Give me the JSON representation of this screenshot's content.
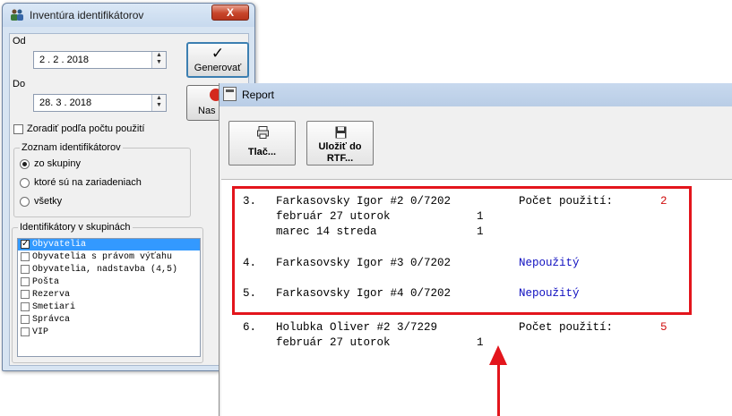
{
  "dialog": {
    "title": "Inventúra identifikátorov",
    "close_label": "X",
    "od_label": "Od",
    "od_value": "2 . 2 . 2018",
    "do_label": "Do",
    "do_value": "28. 3 . 2018",
    "generate_label": "Generovať",
    "nas_label": "Nas",
    "sort_checkbox_label": "Zoradiť podľa počtu použití",
    "list_group": {
      "title": "Zoznam identifikátorov",
      "options": [
        "zo skupiny",
        "ktoré sú na zariadeniach",
        "všetky"
      ],
      "selected_index": 0
    },
    "groups_group": {
      "title": "Identifikátory v skupinách",
      "items": [
        {
          "label": "Obyvatelia",
          "checked": true
        },
        {
          "label": "Obyvatelia s právom výťahu",
          "checked": false
        },
        {
          "label": "Obyvatelia, nadstavba (4,5)",
          "checked": false
        },
        {
          "label": "Pošta",
          "checked": false
        },
        {
          "label": "Rezerva",
          "checked": false
        },
        {
          "label": "Smetiari",
          "checked": false
        },
        {
          "label": "Správca",
          "checked": false
        },
        {
          "label": "VIP",
          "checked": false
        }
      ]
    }
  },
  "report": {
    "title": "Report",
    "print_label": "Tlač...",
    "save_label_1": "Uložiť do",
    "save_label_2": "RTF...",
    "entries": [
      {
        "num": "3.",
        "name": "Farkasovsky Igor #2 0/7202",
        "status_label": "Počet použití:",
        "count": "2",
        "details": [
          {
            "date": "február 27 utorok",
            "count": "1"
          },
          {
            "date": "marec 14 streda",
            "count": "1"
          }
        ]
      },
      {
        "num": "4.",
        "name": "Farkasovsky Igor #3 0/7202",
        "status": "Nepoužitý"
      },
      {
        "num": "5.",
        "name": "Farkasovsky Igor #4 0/7202",
        "status": "Nepoužitý"
      },
      {
        "num": "6.",
        "name": "Holubka Oliver #2 3/7229",
        "status_label": "Počet použití:",
        "count": "5",
        "details": [
          {
            "date": "február 27 utorok",
            "count": "1"
          }
        ]
      }
    ]
  },
  "colors": {
    "highlight": "#e3151c",
    "count_red": "#d01010",
    "status_blue": "#1010c0",
    "selection": "#3399ff"
  }
}
